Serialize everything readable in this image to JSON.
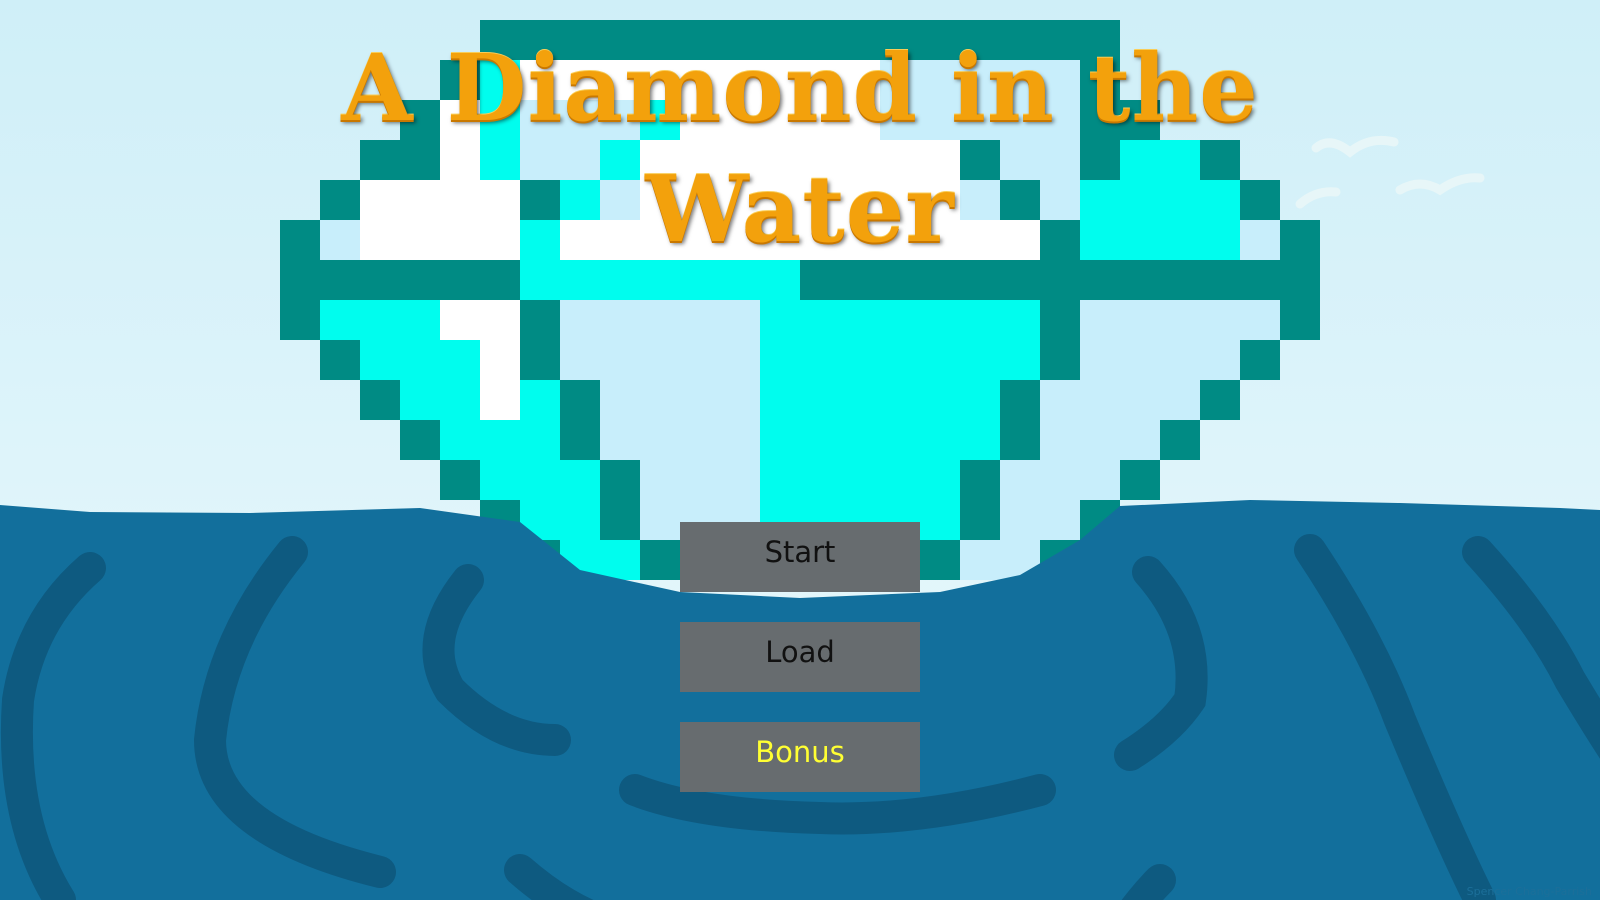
{
  "title": {
    "line1": "A Diamond in the",
    "line2": "Water"
  },
  "menu": {
    "start_label": "Start",
    "load_label": "Load",
    "bonus_label": "Bonus"
  },
  "credit": "Spencer Chang-Parrish",
  "colors": {
    "sky_top": "#cfeff8",
    "sky_bottom": "#ecf9fc",
    "water": "#126f9c",
    "water_wave": "#0e5a80",
    "diamond_outline": "#008b84",
    "diamond_cyan": "#00fdee",
    "diamond_pale": "#c8eefb",
    "diamond_white": "#ffffff",
    "title_gold": "#f3a10c",
    "button_bg": "#676c6f",
    "bonus_text": "#ffff33"
  }
}
